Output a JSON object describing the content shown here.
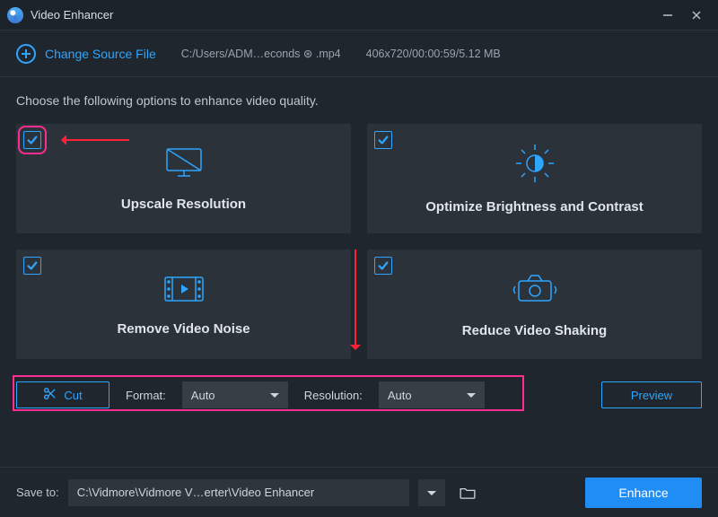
{
  "window": {
    "title": "Video Enhancer"
  },
  "source": {
    "change_label": "Change Source File",
    "file_path": "C:/Users/ADM…econds ⊛ .mp4",
    "file_meta": "406x720/00:00:59/5.12 MB"
  },
  "instruction": "Choose the following options to enhance video quality.",
  "cards": [
    {
      "label": "Upscale Resolution",
      "icon": "monitor-up-icon",
      "checked": true,
      "highlight": true
    },
    {
      "label": "Optimize Brightness and Contrast",
      "icon": "brightness-icon",
      "checked": true,
      "highlight": false
    },
    {
      "label": "Remove Video Noise",
      "icon": "film-noise-icon",
      "checked": true,
      "highlight": false
    },
    {
      "label": "Reduce Video Shaking",
      "icon": "camera-shake-icon",
      "checked": true,
      "highlight": false
    }
  ],
  "controls": {
    "cut_label": "Cut",
    "format_label": "Format:",
    "format_value": "Auto",
    "resolution_label": "Resolution:",
    "resolution_value": "Auto",
    "preview_label": "Preview"
  },
  "footer": {
    "save_label": "Save to:",
    "save_path": "C:\\Vidmore\\Vidmore V…erter\\Video Enhancer",
    "enhance_label": "Enhance"
  },
  "colors": {
    "accent": "#2ea6ff",
    "primary_button": "#1f8df4",
    "annotation": "#ff2e8e",
    "arrow": "#ff2037"
  }
}
